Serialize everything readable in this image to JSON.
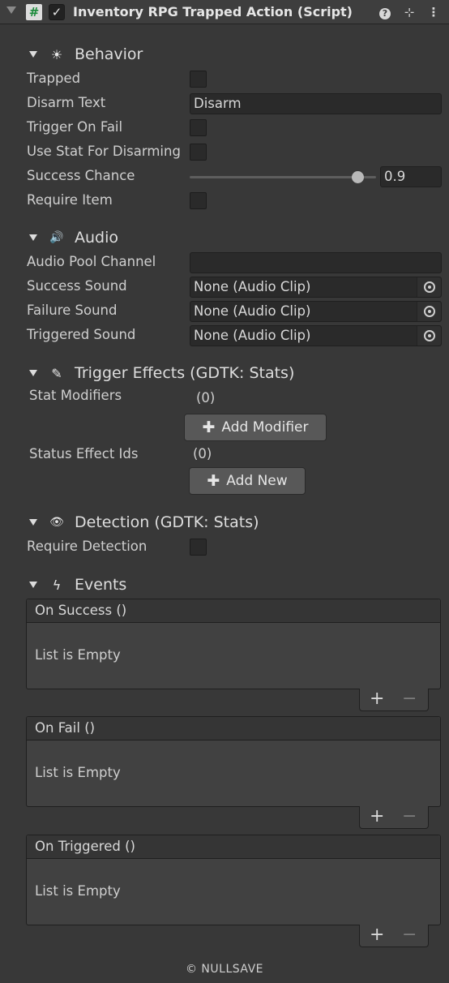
{
  "header": {
    "title": "Inventory RPG Trapped Action (Script)",
    "script_glyph": "#",
    "enabled_glyph": "✓",
    "help_glyph": "?",
    "presets_glyph": "⊹",
    "more_glyph": "⋮"
  },
  "behavior": {
    "title": "Behavior",
    "icon_glyph": "☀",
    "trapped_label": "Trapped",
    "disarm_text_label": "Disarm Text",
    "disarm_text_value": "Disarm",
    "trigger_on_fail_label": "Trigger On Fail",
    "use_stat_label": "Use Stat For Disarming",
    "success_chance_label": "Success Chance",
    "success_chance_value": "0.9",
    "success_chance_fraction": 0.9,
    "require_item_label": "Require Item"
  },
  "audio": {
    "title": "Audio",
    "icon_glyph": "🔊",
    "pool_channel_label": "Audio Pool Channel",
    "pool_channel_value": "",
    "success_sound_label": "Success Sound",
    "success_sound_value": "None (Audio Clip)",
    "failure_sound_label": "Failure Sound",
    "failure_sound_value": "None (Audio Clip)",
    "triggered_sound_label": "Triggered Sound",
    "triggered_sound_value": "None (Audio Clip)"
  },
  "trigger_effects": {
    "title": "Trigger Effects (GDTK: Stats)",
    "icon_glyph": "✎",
    "stat_modifiers_label": "Stat Modifiers",
    "stat_modifiers_count": "(0)",
    "add_modifier_label": "Add Modifier",
    "status_effect_label": "Status Effect Ids",
    "status_effect_count": "(0)",
    "add_new_label": "Add New",
    "plus_glyph": "✚"
  },
  "detection": {
    "title": "Detection (GDTK: Stats)",
    "icon_glyph": "👁",
    "require_detection_label": "Require Detection"
  },
  "events": {
    "title": "Events",
    "icon_glyph": "ϟ",
    "list_empty": "List is Empty",
    "on_success": "On Success ()",
    "on_fail": "On Fail ()",
    "on_triggered": "On Triggered ()",
    "add_glyph": "+",
    "remove_glyph": "−"
  },
  "footer": "© NULLSAVE"
}
